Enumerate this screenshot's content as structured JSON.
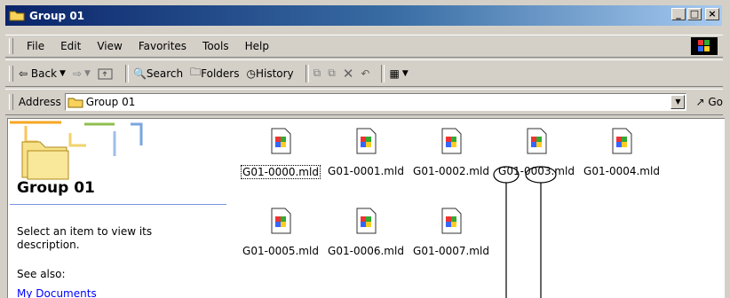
{
  "window": {
    "title": "Group 01"
  },
  "menu": [
    "File",
    "Edit",
    "View",
    "Favorites",
    "Tools",
    "Help"
  ],
  "toolbar": {
    "back": "Back",
    "search": "Search",
    "folders": "Folders",
    "history": "History"
  },
  "address": {
    "label": "Address",
    "value": "Group 01",
    "go": "Go"
  },
  "left_pane": {
    "title": "Group 01",
    "description": "Select an item to view its description.",
    "see_also": "See also:",
    "link": "My Documents"
  },
  "files": [
    "G01-0000.mld",
    "G01-0001.mld",
    "G01-0002.mld",
    "G01-0003.mld",
    "G01-0004.mld",
    "G01-0005.mld",
    "G01-0006.mld",
    "G01-0007.mld"
  ],
  "annotation": {
    "part_a": "G01",
    "part_b": "0003"
  }
}
